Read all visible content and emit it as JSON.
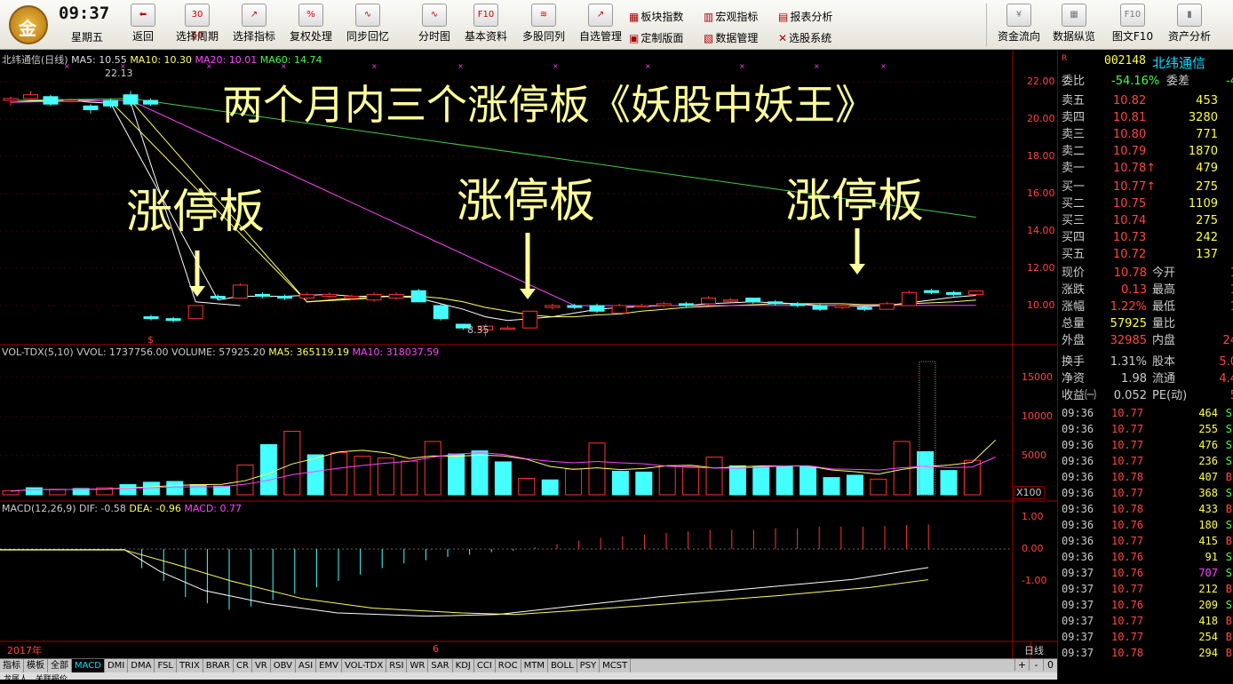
{
  "topbar": {
    "logo_char": "金",
    "time": "09:37",
    "weekday": "星期五",
    "buttons": [
      {
        "label": "返回",
        "icon": "back-arrow-icon",
        "glyph": "⬅"
      },
      {
        "label": "选择周期",
        "icon": "period-icon",
        "glyph": "30 60"
      },
      {
        "label": "选择指标",
        "icon": "indicator-icon",
        "glyph": "↗"
      },
      {
        "label": "复权处理",
        "icon": "adjust-icon",
        "glyph": "%"
      },
      {
        "label": "同步回忆",
        "icon": "sync-icon",
        "glyph": "∿"
      },
      {
        "label": "分时图",
        "icon": "intraday-icon",
        "glyph": "∿"
      },
      {
        "label": "基本资料",
        "icon": "f10-icon",
        "glyph": "F10"
      },
      {
        "label": "多股同列",
        "icon": "multi-icon",
        "glyph": "≋"
      },
      {
        "label": "自选管理",
        "icon": "watchlist-icon",
        "glyph": "↗"
      }
    ],
    "small_buttons": [
      {
        "label": "板块指数",
        "icon": "sector-icon",
        "glyph": "▦"
      },
      {
        "label": "宏观指标",
        "icon": "macro-icon",
        "glyph": "▥"
      },
      {
        "label": "报表分析",
        "icon": "report-icon",
        "glyph": "▤"
      },
      {
        "label": "定制版面",
        "icon": "layout-icon",
        "glyph": "▣"
      },
      {
        "label": "数据管理",
        "icon": "data-icon",
        "glyph": "▧"
      },
      {
        "label": "选股系统",
        "icon": "screen-icon",
        "glyph": "✕"
      }
    ],
    "right_buttons": [
      {
        "label": "资金流向",
        "icon": "fund-flow-icon",
        "glyph": "¥"
      },
      {
        "label": "数据纵览",
        "icon": "overview-icon",
        "glyph": "▦"
      },
      {
        "label": "图文F10",
        "icon": "f10-doc-icon",
        "glyph": "F10"
      },
      {
        "label": "资产分析",
        "icon": "asset-icon",
        "glyph": "▮"
      }
    ]
  },
  "kline": {
    "header_name": "北纬通信(日线)",
    "ma5": "MA5: 10.55",
    "ma10": "MA10: 10.30",
    "ma20": "MA20: 10.01",
    "ma60": "MA60: 14.74",
    "high_label": "22.13",
    "low_label": "8.35",
    "year_label": "2017年",
    "month_label": "6",
    "period_label": "日线",
    "price_axis": [
      "22.00",
      "20.00",
      "18.00",
      "16.00",
      "14.00",
      "12.00",
      "10.00"
    ],
    "title": "两个月内三个涨停板《妖股中妖王》",
    "limit_up_label": "涨停板",
    "dollar_mark": "$"
  },
  "volume": {
    "header": "VOL-TDX(5,10)",
    "vvol": "VVOL: 1737756.00",
    "volume": "VOLUME: 57925.20",
    "ma5": "MA5: 365119.19",
    "ma10": "MA10: 318037.59",
    "axis": [
      "15000",
      "10000",
      "5000"
    ],
    "unit": "X100"
  },
  "macd": {
    "header": "MACD(12,26,9)",
    "dif": "DIF: -0.58",
    "dea": "DEA: -0.96",
    "macd": "MACD: 0.77",
    "axis": [
      "1.00",
      "0.00",
      "-1.00"
    ]
  },
  "quote": {
    "code": "002148",
    "name": "北纬通信",
    "mark": "R",
    "weibi_label": "委比",
    "weibi": "-54.16%",
    "weicha_label": "委差",
    "weicha": "-4",
    "sells": [
      {
        "label": "卖五",
        "price": "10.82",
        "vol": "453"
      },
      {
        "label": "卖四",
        "price": "10.81",
        "vol": "3280"
      },
      {
        "label": "卖三",
        "price": "10.80",
        "vol": "771"
      },
      {
        "label": "卖二",
        "price": "10.79",
        "vol": "1870"
      },
      {
        "label": "卖一",
        "price": "10.78↑",
        "vol": "479"
      }
    ],
    "buys": [
      {
        "label": "买一",
        "price": "10.77↑",
        "vol": "275"
      },
      {
        "label": "买二",
        "price": "10.75",
        "vol": "1109"
      },
      {
        "label": "买三",
        "price": "10.74",
        "vol": "275"
      },
      {
        "label": "买四",
        "price": "10.73",
        "vol": "242"
      },
      {
        "label": "买五",
        "price": "10.72",
        "vol": "137"
      }
    ],
    "stats1": [
      {
        "l": "现价",
        "v": "10.78",
        "l2": "今开",
        "v2": "1"
      },
      {
        "l": "涨跌",
        "v": "0.13",
        "l2": "最高",
        "v2": "1"
      },
      {
        "l": "涨幅",
        "v": "1.22%",
        "l2": "最低",
        "v2": "1"
      },
      {
        "l": "总量",
        "v": "57925",
        "l2": "量比",
        "v2": ""
      },
      {
        "l": "外盘",
        "v": "32985",
        "l2": "内盘",
        "v2": "24"
      }
    ],
    "stats2": [
      {
        "l": "换手",
        "v": "1.31%",
        "l2": "股本",
        "v2": "5.0"
      },
      {
        "l": "净资",
        "v": "1.98",
        "l2": "流通",
        "v2": "4.4"
      },
      {
        "l": "收益㈠",
        "v": "0.052",
        "l2": "PE(动)",
        "v2": "5"
      }
    ],
    "ticks": [
      [
        "09:36",
        "10.77",
        "464",
        "S"
      ],
      [
        "09:36",
        "10.77",
        "255",
        "S"
      ],
      [
        "09:36",
        "10.77",
        "476",
        "S"
      ],
      [
        "09:36",
        "10.77",
        "236",
        "S"
      ],
      [
        "09:36",
        "10.78",
        "407",
        "B"
      ],
      [
        "09:36",
        "10.77",
        "368",
        "S"
      ],
      [
        "09:36",
        "10.78",
        "433",
        "B"
      ],
      [
        "09:36",
        "10.76",
        "180",
        "S"
      ],
      [
        "09:36",
        "10.77",
        "415",
        "B"
      ],
      [
        "09:36",
        "10.76",
        "91",
        "S"
      ],
      [
        "09:37",
        "10.76",
        "707",
        "S"
      ],
      [
        "09:37",
        "10.77",
        "212",
        "B"
      ],
      [
        "09:37",
        "10.76",
        "209",
        "S"
      ],
      [
        "09:37",
        "10.77",
        "418",
        "B"
      ],
      [
        "09:37",
        "10.77",
        "254",
        "B"
      ],
      [
        "09:37",
        "10.78",
        "294",
        "B"
      ]
    ]
  },
  "tabs": [
    "指标",
    "模板",
    "全部",
    "MACD",
    "DMI",
    "DMA",
    "FSL",
    "TRIX",
    "BRAR",
    "CR",
    "VR",
    "OBV",
    "ASI",
    "EMV",
    "VOL-TDX",
    "RSI",
    "WR",
    "SAR",
    "KDJ",
    "CCI",
    "ROC",
    "MTM",
    "BOLL",
    "PSY",
    "MCST"
  ],
  "tab_controls": [
    "+",
    "-",
    "0"
  ],
  "bottom": {
    "a": "龙属人",
    "b": "关联报价"
  },
  "chart_data": [
    {
      "type": "candlestick",
      "title": "两个月内三个涨停板《妖股中妖王》",
      "ylim": [
        8,
        22
      ],
      "candles": [
        [
          21,
          21.1,
          20.7,
          21.2
        ],
        [
          21.1,
          21.3,
          21,
          21.5
        ],
        [
          21.2,
          20.8,
          20.7,
          21.3
        ],
        [
          21,
          21,
          20.9,
          21.1
        ],
        [
          20.7,
          20.5,
          20.3,
          20.8
        ],
        [
          21,
          20.7,
          20.6,
          21.1
        ],
        [
          21.3,
          20.8,
          20.7,
          21.5
        ],
        [
          21,
          20.8,
          20.7,
          21.1
        ],
        [
          9.4,
          9.3,
          9.2,
          9.5
        ],
        [
          9.3,
          9.2,
          9.1,
          9.4
        ],
        [
          9.3,
          10,
          9.3,
          10
        ],
        [
          10.5,
          10.4,
          10.3,
          10.6
        ],
        [
          10.4,
          11.1,
          10.4,
          11.2
        ],
        [
          10.6,
          10.5,
          10.4,
          10.7
        ],
        [
          10.5,
          10.4,
          10.3,
          10.6
        ],
        [
          10.4,
          10.6,
          10.3,
          10.7
        ],
        [
          10.5,
          10.6,
          10.4,
          10.7
        ],
        [
          10.4,
          10.5,
          10.3,
          10.6
        ],
        [
          10.3,
          10.6,
          10.2,
          10.7
        ],
        [
          10.4,
          10.6,
          10.3,
          10.7
        ],
        [
          10.8,
          10.2,
          10.2,
          10.9
        ],
        [
          10,
          9.3,
          9.2,
          10.1
        ],
        [
          9.0,
          8.8,
          8.7,
          9.0
        ],
        [
          8.7,
          8.9,
          8.35,
          9.0
        ],
        [
          8.8,
          8.8,
          8.7,
          8.9
        ],
        [
          8.8,
          9.7,
          8.8,
          9.7
        ],
        [
          9.9,
          10.0,
          9.8,
          10.1
        ],
        [
          10.0,
          9.9,
          9.8,
          10.1
        ],
        [
          10.0,
          9.7,
          9.6,
          10.1
        ],
        [
          9.6,
          10.0,
          9.5,
          10.1
        ],
        [
          10.0,
          10.0,
          9.9,
          10.1
        ],
        [
          10.0,
          10.1,
          9.9,
          10.2
        ],
        [
          10.1,
          10.0,
          9.9,
          10.2
        ],
        [
          10.1,
          10.4,
          10.0,
          10.5
        ],
        [
          10.3,
          10.3,
          10.2,
          10.4
        ],
        [
          10.4,
          10.2,
          10.1,
          10.4
        ],
        [
          10.2,
          10.1,
          10.0,
          10.3
        ],
        [
          10.1,
          10.0,
          9.9,
          10.2
        ],
        [
          10.0,
          9.8,
          9.7,
          10.1
        ],
        [
          9.9,
          10.0,
          9.8,
          10.1
        ],
        [
          9.9,
          9.8,
          9.7,
          10.0
        ],
        [
          9.8,
          10.1,
          9.8,
          10.2
        ],
        [
          10.0,
          10.7,
          10.0,
          10.8
        ],
        [
          10.8,
          10.7,
          10.6,
          10.9
        ],
        [
          10.7,
          10.6,
          10.5,
          10.8
        ],
        [
          10.6,
          10.78,
          10.5,
          10.82
        ]
      ],
      "ma5": [
        20.9,
        20.95,
        21,
        21,
        20.9,
        20.85,
        null,
        null,
        null,
        null,
        null,
        10.3,
        10.5,
        10.5,
        10.5,
        10.55,
        10.6,
        10.5,
        10.5,
        10.5,
        10.4,
        10.1,
        9.8,
        9.4,
        9.2,
        9.3,
        9.4,
        9.6,
        9.8,
        9.9,
        9.95,
        10,
        10,
        10.1,
        10.15,
        10.2,
        10.15,
        10.1,
        10,
        10,
        9.95,
        10,
        10.15,
        10.3,
        10.45,
        10.55
      ],
      "ma10": [
        21,
        21,
        21,
        21,
        21,
        20.95,
        null,
        null,
        null,
        null,
        null,
        null,
        null,
        null,
        null,
        10.2,
        10.3,
        10.4,
        10.45,
        10.5,
        10.5,
        10.4,
        10.2,
        9.9,
        9.7,
        9.5,
        9.4,
        9.4,
        9.5,
        9.55,
        9.7,
        9.8,
        9.9,
        9.95,
        10,
        10.05,
        10.1,
        10.1,
        10.1,
        10.1,
        10.05,
        10.05,
        10.1,
        10.15,
        10.2,
        10.3
      ],
      "ma20_start": [
        20.9,
        21
      ],
      "ma20_end": 10.01,
      "ma60_start": [
        21,
        21.1
      ],
      "ma60_end": 14.74
    },
    {
      "type": "bar",
      "name": "VOLUME",
      "ylim": [
        0,
        17000
      ],
      "values": [
        500,
        900,
        700,
        800,
        900,
        1300,
        1600,
        1700,
        1300,
        1100,
        3800,
        6400,
        8100,
        5100,
        5400,
        4900,
        4700,
        4300,
        6800,
        5200,
        5600,
        4200,
        2100,
        1900,
        3300,
        6600,
        3000,
        2900,
        3700,
        3600,
        4800,
        3700,
        3600,
        3600,
        3600,
        2200,
        2500,
        2000,
        6800,
        5500,
        3100,
        4400,
        17000
      ],
      "up": [
        true,
        false,
        true,
        false,
        true,
        false,
        false,
        false,
        false,
        false,
        true,
        false,
        true,
        false,
        true,
        true,
        true,
        true,
        true,
        false,
        false,
        false,
        true,
        false,
        true,
        true,
        false,
        false,
        true,
        true,
        true,
        false,
        false,
        false,
        false,
        false,
        false,
        true,
        true,
        false,
        false,
        true,
        true
      ]
    },
    {
      "type": "bar",
      "name": "MACD",
      "ylim": [
        -1.5,
        1.5
      ],
      "values": [
        -0.02,
        -0.02,
        -0.03,
        -0.03,
        -0.04,
        -0.03,
        -0.6,
        -1.0,
        -1.5,
        -1.7,
        -1.9,
        -1.8,
        -1.6,
        -1.4,
        -1.2,
        -1.0,
        -0.8,
        -0.6,
        -0.45,
        -0.35,
        -0.25,
        -0.18,
        -0.1,
        -0.05,
        0.05,
        0.15,
        0.25,
        0.35,
        0.4,
        0.45,
        0.5,
        0.55,
        0.6,
        0.6,
        0.6,
        0.65,
        0.65,
        0.7,
        0.7,
        0.7,
        0.72,
        0.75,
        0.77
      ]
    }
  ]
}
